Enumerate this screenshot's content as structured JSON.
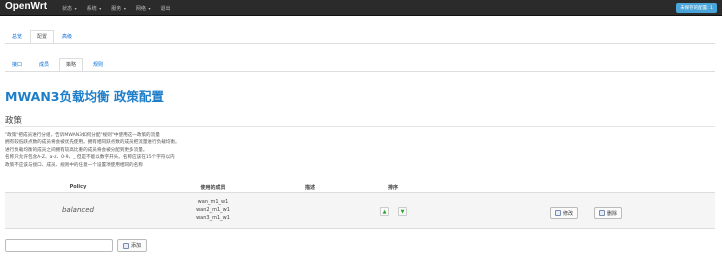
{
  "header": {
    "brand": "OpenWrt",
    "nav": [
      {
        "label": "状态",
        "caret": "▾"
      },
      {
        "label": "系统",
        "caret": "▾"
      },
      {
        "label": "服务",
        "caret": "▾"
      },
      {
        "label": "网络",
        "caret": "▾"
      },
      {
        "label": "退出",
        "caret": ""
      }
    ],
    "status_badge": "未保存的配置: 1"
  },
  "tabs_primary": [
    {
      "label": "总览",
      "active": false
    },
    {
      "label": "配置",
      "active": true
    },
    {
      "label": "高级",
      "active": false
    }
  ],
  "tabs_secondary": [
    {
      "label": "接口",
      "active": false
    },
    {
      "label": "成员",
      "active": false
    },
    {
      "label": "策略",
      "active": true
    },
    {
      "label": "规则",
      "active": false
    }
  ],
  "page_title": "MWAN3负载均衡 政策配置",
  "section": {
    "title": "政策",
    "description": [
      "\"政策\"把成员进行分组，告诉MWAN3如何分配\"规则\"中使用这一政策的流量",
      "拥有较低跃点数的成员将会被优先使用。拥有相同跃点数的成员把流量进行负载均衡。",
      "进行负载均衡的成员之间拥有较高比重的成员将会被分配到更多流量。",
      "名称只允许包含A-Z、a-z、0-9、_ 但是不能以数字开头。名称应该在15个字符以内",
      "政策不应该与接口、成员、规则中的任意一个设置项使用相同的名称"
    ]
  },
  "table": {
    "headers": [
      "Policy",
      "使用的成员",
      "描述",
      "排序"
    ],
    "rows": [
      {
        "policy": "balanced",
        "members": [
          "wan_m1_w1",
          "wan2_m1_w1",
          "wan3_m1_w1"
        ],
        "description": "",
        "sort_up": "▲",
        "sort_down": "▼",
        "edit_label": "修改",
        "delete_label": "删除"
      }
    ]
  },
  "add": {
    "input_value": "",
    "button_label": "添加"
  },
  "colors": {
    "title_blue": "#1e7ec9",
    "link_blue": "#0069d6",
    "topbar": "#2b2b2b",
    "badge": "#49a4d9"
  }
}
